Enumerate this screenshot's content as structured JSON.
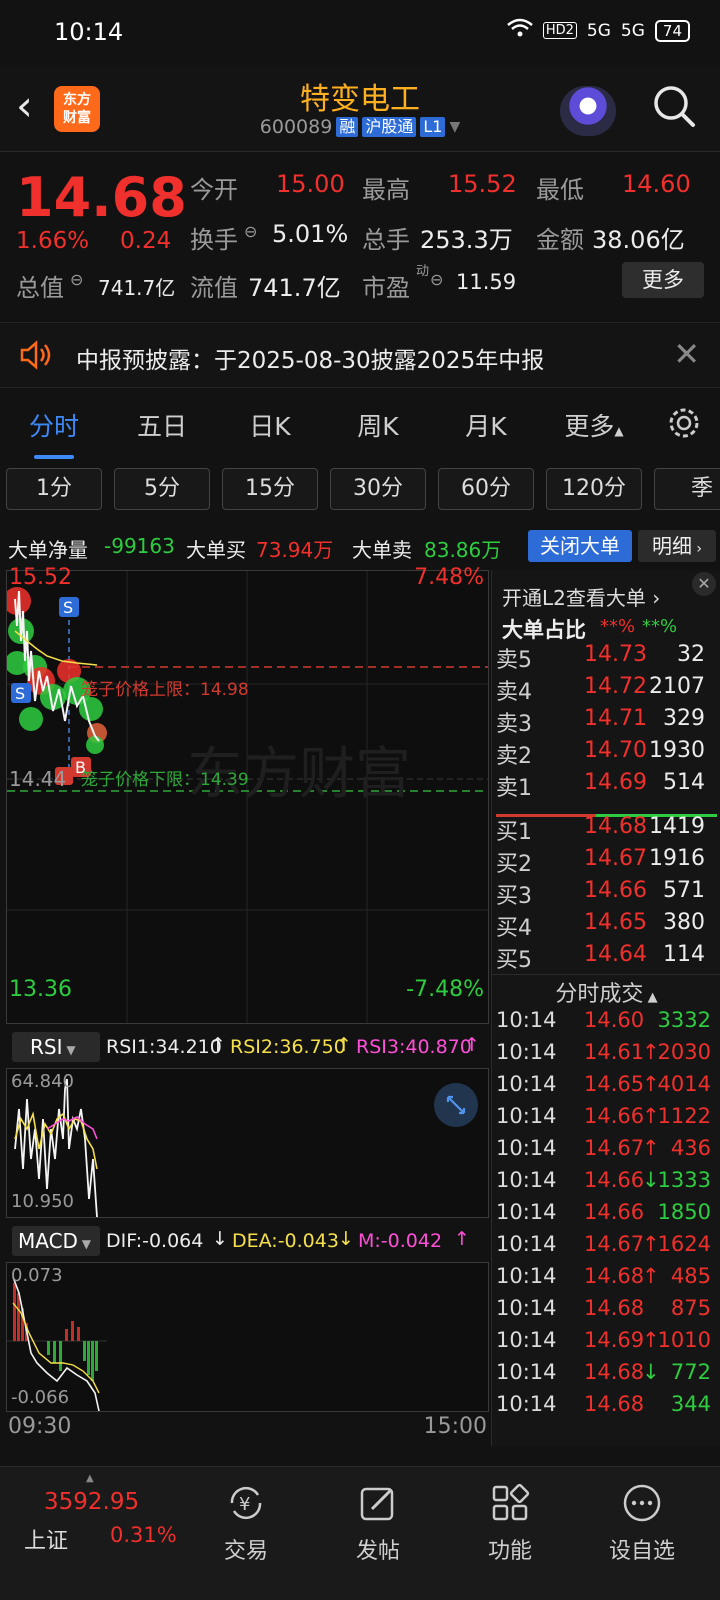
{
  "status": {
    "time": "10:14",
    "net1": "5G",
    "net2": "5G",
    "hd": "HD2",
    "battery": "74"
  },
  "header": {
    "title": "特变电工",
    "code": "600089",
    "tag1": "融",
    "tag2": "沪股通",
    "tag3": "L1",
    "logo_line1": "东方",
    "logo_line2": "财富"
  },
  "quote": {
    "price": "14.68",
    "pct": "1.66%",
    "change": "0.24",
    "open_label": "今开",
    "open": "15.00",
    "high_label": "最高",
    "high": "15.52",
    "low_label": "最低",
    "low": "14.60",
    "turnover_label": "换手",
    "turnover": "5.01%",
    "volume_label": "总手",
    "volume": "253.3万",
    "amount_label": "金额",
    "amount": "38.06亿",
    "mktcap_label": "总值",
    "mktcap": "741.7亿",
    "float_label": "流值",
    "float": "741.7亿",
    "pe_label": "市盈",
    "pe_sup": "动",
    "pe": "11.59",
    "more": "更多"
  },
  "notice": {
    "text": "中报预披露：于2025-08-30披露2025年中报"
  },
  "tabs": [
    "分时",
    "五日",
    "日K",
    "周K",
    "月K",
    "更多"
  ],
  "chips": [
    "1分",
    "5分",
    "15分",
    "30分",
    "60分",
    "120分",
    "季"
  ],
  "bigorder": {
    "net_label": "大单净量",
    "net": "-99163",
    "buy_label": "大单买",
    "buy": "73.94万",
    "sell_label": "大单卖",
    "sell": "83.86万",
    "close_btn": "关闭大单",
    "detail_btn": "明细"
  },
  "chart": {
    "price_top": "15.52",
    "pct_top": "7.48%",
    "price_bottom": "13.36",
    "pct_bottom": "-7.48%",
    "mid_label": "14.44",
    "upper_limit_label": "笼子价格上限：14.98",
    "lower_limit_label": "笼子价格下限：14.39",
    "watermark": "东方财富",
    "marker_s": "S",
    "marker_b": "B",
    "time_start": "09:30",
    "time_end": "15:00"
  },
  "rsi": {
    "name": "RSI",
    "rsi1": "RSI1:34.210",
    "rsi2": "RSI2:36.750",
    "rsi3": "RSI3:40.870",
    "top": "64.840",
    "bottom": "10.950"
  },
  "macd": {
    "name": "MACD",
    "dif": "DIF:-0.064",
    "dea": "DEA:-0.043",
    "m": "M:-0.042",
    "top": "0.073",
    "bottom": "-0.066"
  },
  "panel": {
    "l2_link": "开通L2查看大单",
    "ratio_label": "大单占比",
    "ratio_red": "**%",
    "ratio_green": "**%",
    "sells": [
      {
        "label": "卖5",
        "price": "14.73",
        "vol": "32"
      },
      {
        "label": "卖4",
        "price": "14.72",
        "vol": "2107"
      },
      {
        "label": "卖3",
        "price": "14.71",
        "vol": "329"
      },
      {
        "label": "卖2",
        "price": "14.70",
        "vol": "1930"
      },
      {
        "label": "卖1",
        "price": "14.69",
        "vol": "514"
      }
    ],
    "buys": [
      {
        "label": "买1",
        "price": "14.68",
        "vol": "1419"
      },
      {
        "label": "买2",
        "price": "14.67",
        "vol": "1916"
      },
      {
        "label": "买3",
        "price": "14.66",
        "vol": "571"
      },
      {
        "label": "买4",
        "price": "14.65",
        "vol": "380"
      },
      {
        "label": "买5",
        "price": "14.64",
        "vol": "114"
      }
    ],
    "trades_title": "分时成交",
    "trades": [
      {
        "time": "10:14",
        "price": "14.60",
        "arrow": "",
        "vol": "3332",
        "dir": "green"
      },
      {
        "time": "10:14",
        "price": "14.61",
        "arrow": "↑",
        "vol": "2030",
        "dir": "red"
      },
      {
        "time": "10:14",
        "price": "14.65",
        "arrow": "↑",
        "vol": "4014",
        "dir": "red"
      },
      {
        "time": "10:14",
        "price": "14.66",
        "arrow": "↑",
        "vol": "1122",
        "dir": "red"
      },
      {
        "time": "10:14",
        "price": "14.67",
        "arrow": "↑",
        "vol": "436",
        "dir": "red"
      },
      {
        "time": "10:14",
        "price": "14.66",
        "arrow": "↓",
        "vol": "1333",
        "dir": "green"
      },
      {
        "time": "10:14",
        "price": "14.66",
        "arrow": "",
        "vol": "1850",
        "dir": "green"
      },
      {
        "time": "10:14",
        "price": "14.67",
        "arrow": "↑",
        "vol": "1624",
        "dir": "red"
      },
      {
        "time": "10:14",
        "price": "14.68",
        "arrow": "↑",
        "vol": "485",
        "dir": "red"
      },
      {
        "time": "10:14",
        "price": "14.68",
        "arrow": "",
        "vol": "875",
        "dir": "red"
      },
      {
        "time": "10:14",
        "price": "14.69",
        "arrow": "↑",
        "vol": "1010",
        "dir": "red"
      },
      {
        "time": "10:14",
        "price": "14.68",
        "arrow": "↓",
        "vol": "772",
        "dir": "green"
      },
      {
        "time": "10:14",
        "price": "14.68",
        "arrow": "",
        "vol": "344",
        "dir": "green"
      }
    ]
  },
  "bottomnav": {
    "index_value": "3592.95",
    "index_name": "上证",
    "index_pct": "0.31%",
    "items": [
      "交易",
      "发帖",
      "功能",
      "设自选"
    ]
  },
  "colors": {
    "up": "#f0302c",
    "down": "#2ecc40",
    "accent": "#3d8af7",
    "title": "#ffb020"
  }
}
